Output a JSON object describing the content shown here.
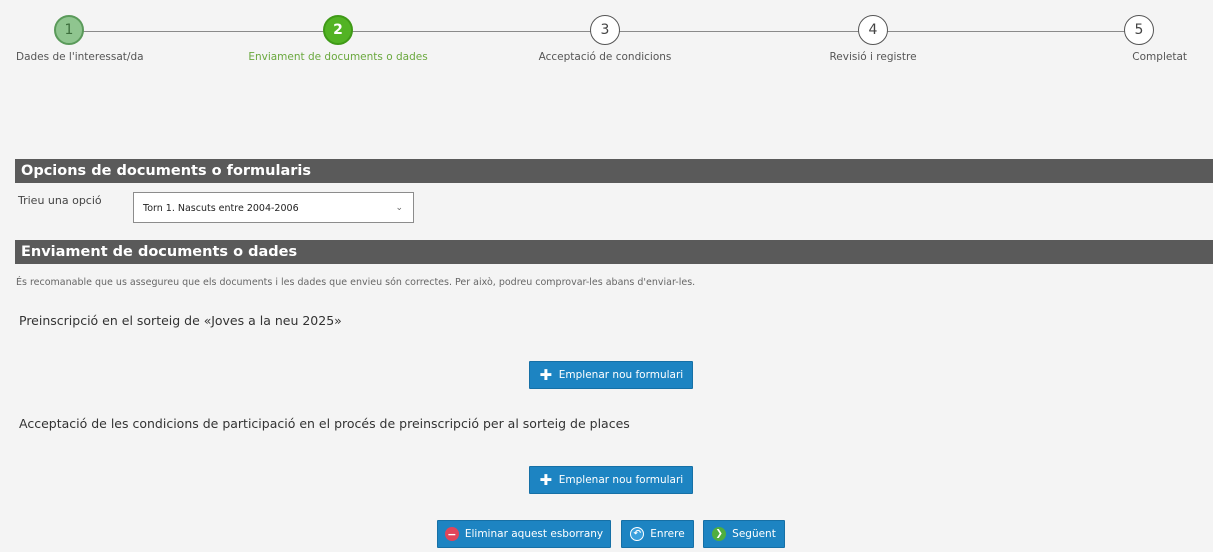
{
  "stepper": {
    "steps": [
      {
        "number": "1",
        "label": "Dades de l'interessat/da",
        "state": "done"
      },
      {
        "number": "2",
        "label": "Enviament de documents o dades",
        "state": "active"
      },
      {
        "number": "3",
        "label": "Acceptació de condicions",
        "state": "pending"
      },
      {
        "number": "4",
        "label": "Revisió i registre",
        "state": "pending"
      },
      {
        "number": "5",
        "label": "Completat",
        "state": "pending"
      }
    ]
  },
  "options_section": {
    "title": "Opcions de documents o formularis",
    "choose_label": "Trieu una opció",
    "selected_option": "Torn 1. Nascuts entre 2004-2006"
  },
  "submission_section": {
    "title": "Enviament de documents o dades",
    "note": "És recomanable que us assegureu que els documents i les dades que envieu són correctes. Per això, podreu comprovar-les abans d'enviar-les.",
    "forms": [
      {
        "title": "Preinscripció en el sorteig de «Joves a la neu 2025»",
        "button_label": "Emplenar nou formulari"
      },
      {
        "title": "Acceptació de les condicions de participació en el procés de preinscripció per al sorteig de places",
        "button_label": "Emplenar nou formulari"
      }
    ]
  },
  "actions": {
    "delete_label": "Eliminar aquest esborrany",
    "back_label": "Enrere",
    "next_label": "Següent"
  },
  "colors": {
    "accent_blue": "#1d84c2",
    "active_green": "#52b324",
    "header_gray": "#5a5a5a"
  }
}
